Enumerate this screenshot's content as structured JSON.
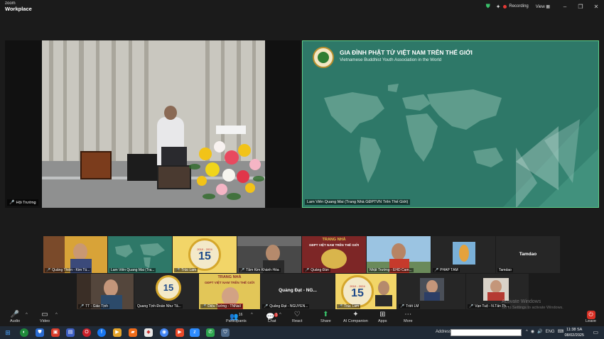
{
  "app": {
    "logo_line1": "zoom",
    "logo_line2": "Workplace",
    "recording_label": "Recording",
    "view_label": "View"
  },
  "main": {
    "left_name": "Hội Trường",
    "right_name": "Lam Viên Quang Mai (Trang Nhà GĐPTVN Trên Thế Giới)",
    "org_title": "GIA ĐÌNH PHẬT TỬ VIỆT NAM TRÊN THẾ GIỚI",
    "org_subtitle": "Vietnamese Buddhist Youth Association in the World"
  },
  "gallery": {
    "row1": [
      {
        "name": "Quảng Thiện - Kim Tú..."
      },
      {
        "name": "Lam Viên Quang Mai (Tra..."
      },
      {
        "name": "Trúc Lam",
        "badge": "15",
        "years": "2010 - 2024"
      },
      {
        "name": "Tâm Kim Khánh Hòa"
      },
      {
        "name": "Quảng Đàn",
        "header": "TRANG NHÀ",
        "sub": "GĐPT VIỆT NAM TRÊN THẾ GIỚI"
      },
      {
        "name": "Nhật Trường - EHD Cam..."
      },
      {
        "name": "PHÁP TÂM"
      },
      {
        "name": "Tamdao",
        "center": "Tamdao"
      }
    ],
    "row2": [
      {
        "name": "TT - Giác Tịnh"
      },
      {
        "name": "Quang Tịnh Đoàn Như Tâ...",
        "badge": "15"
      },
      {
        "name": "Diệu Tường - TNNail",
        "header": "TRANG NHÀ",
        "sub": "GĐPT VIỆT NAM TRÊN THẾ GIỚI"
      },
      {
        "name": "Quảng Đạt - NGUYEN...",
        "center": "Quảng Đạt - NG..."
      },
      {
        "name": "Trúc Lam",
        "badge": "15",
        "years": "2010 - 2024"
      },
      {
        "name": "Triết LM"
      },
      {
        "name": "Vạn Tuệ - N.Tấn Th..."
      }
    ]
  },
  "toolbar": {
    "audio": "Audio",
    "video": "Video",
    "participants": "Participants",
    "participants_count": "16",
    "chat": "Chat",
    "chat_badge": "1",
    "react": "React",
    "share": "Share",
    "ai": "AI Companion",
    "apps": "Apps",
    "more": "More",
    "leave": "Leave"
  },
  "watermark": {
    "line1": "Activate Windows",
    "line2": "Go to Settings to activate Windows."
  },
  "taskbar": {
    "address_label": "Address",
    "lang": "ENG",
    "time": "11:38 SA",
    "date": "08/02/2025"
  },
  "colors": {
    "accent_green": "#39c06a",
    "recording_red": "#e53935",
    "slide_teal": "#2e7868",
    "active_border": "#5fd08a"
  }
}
